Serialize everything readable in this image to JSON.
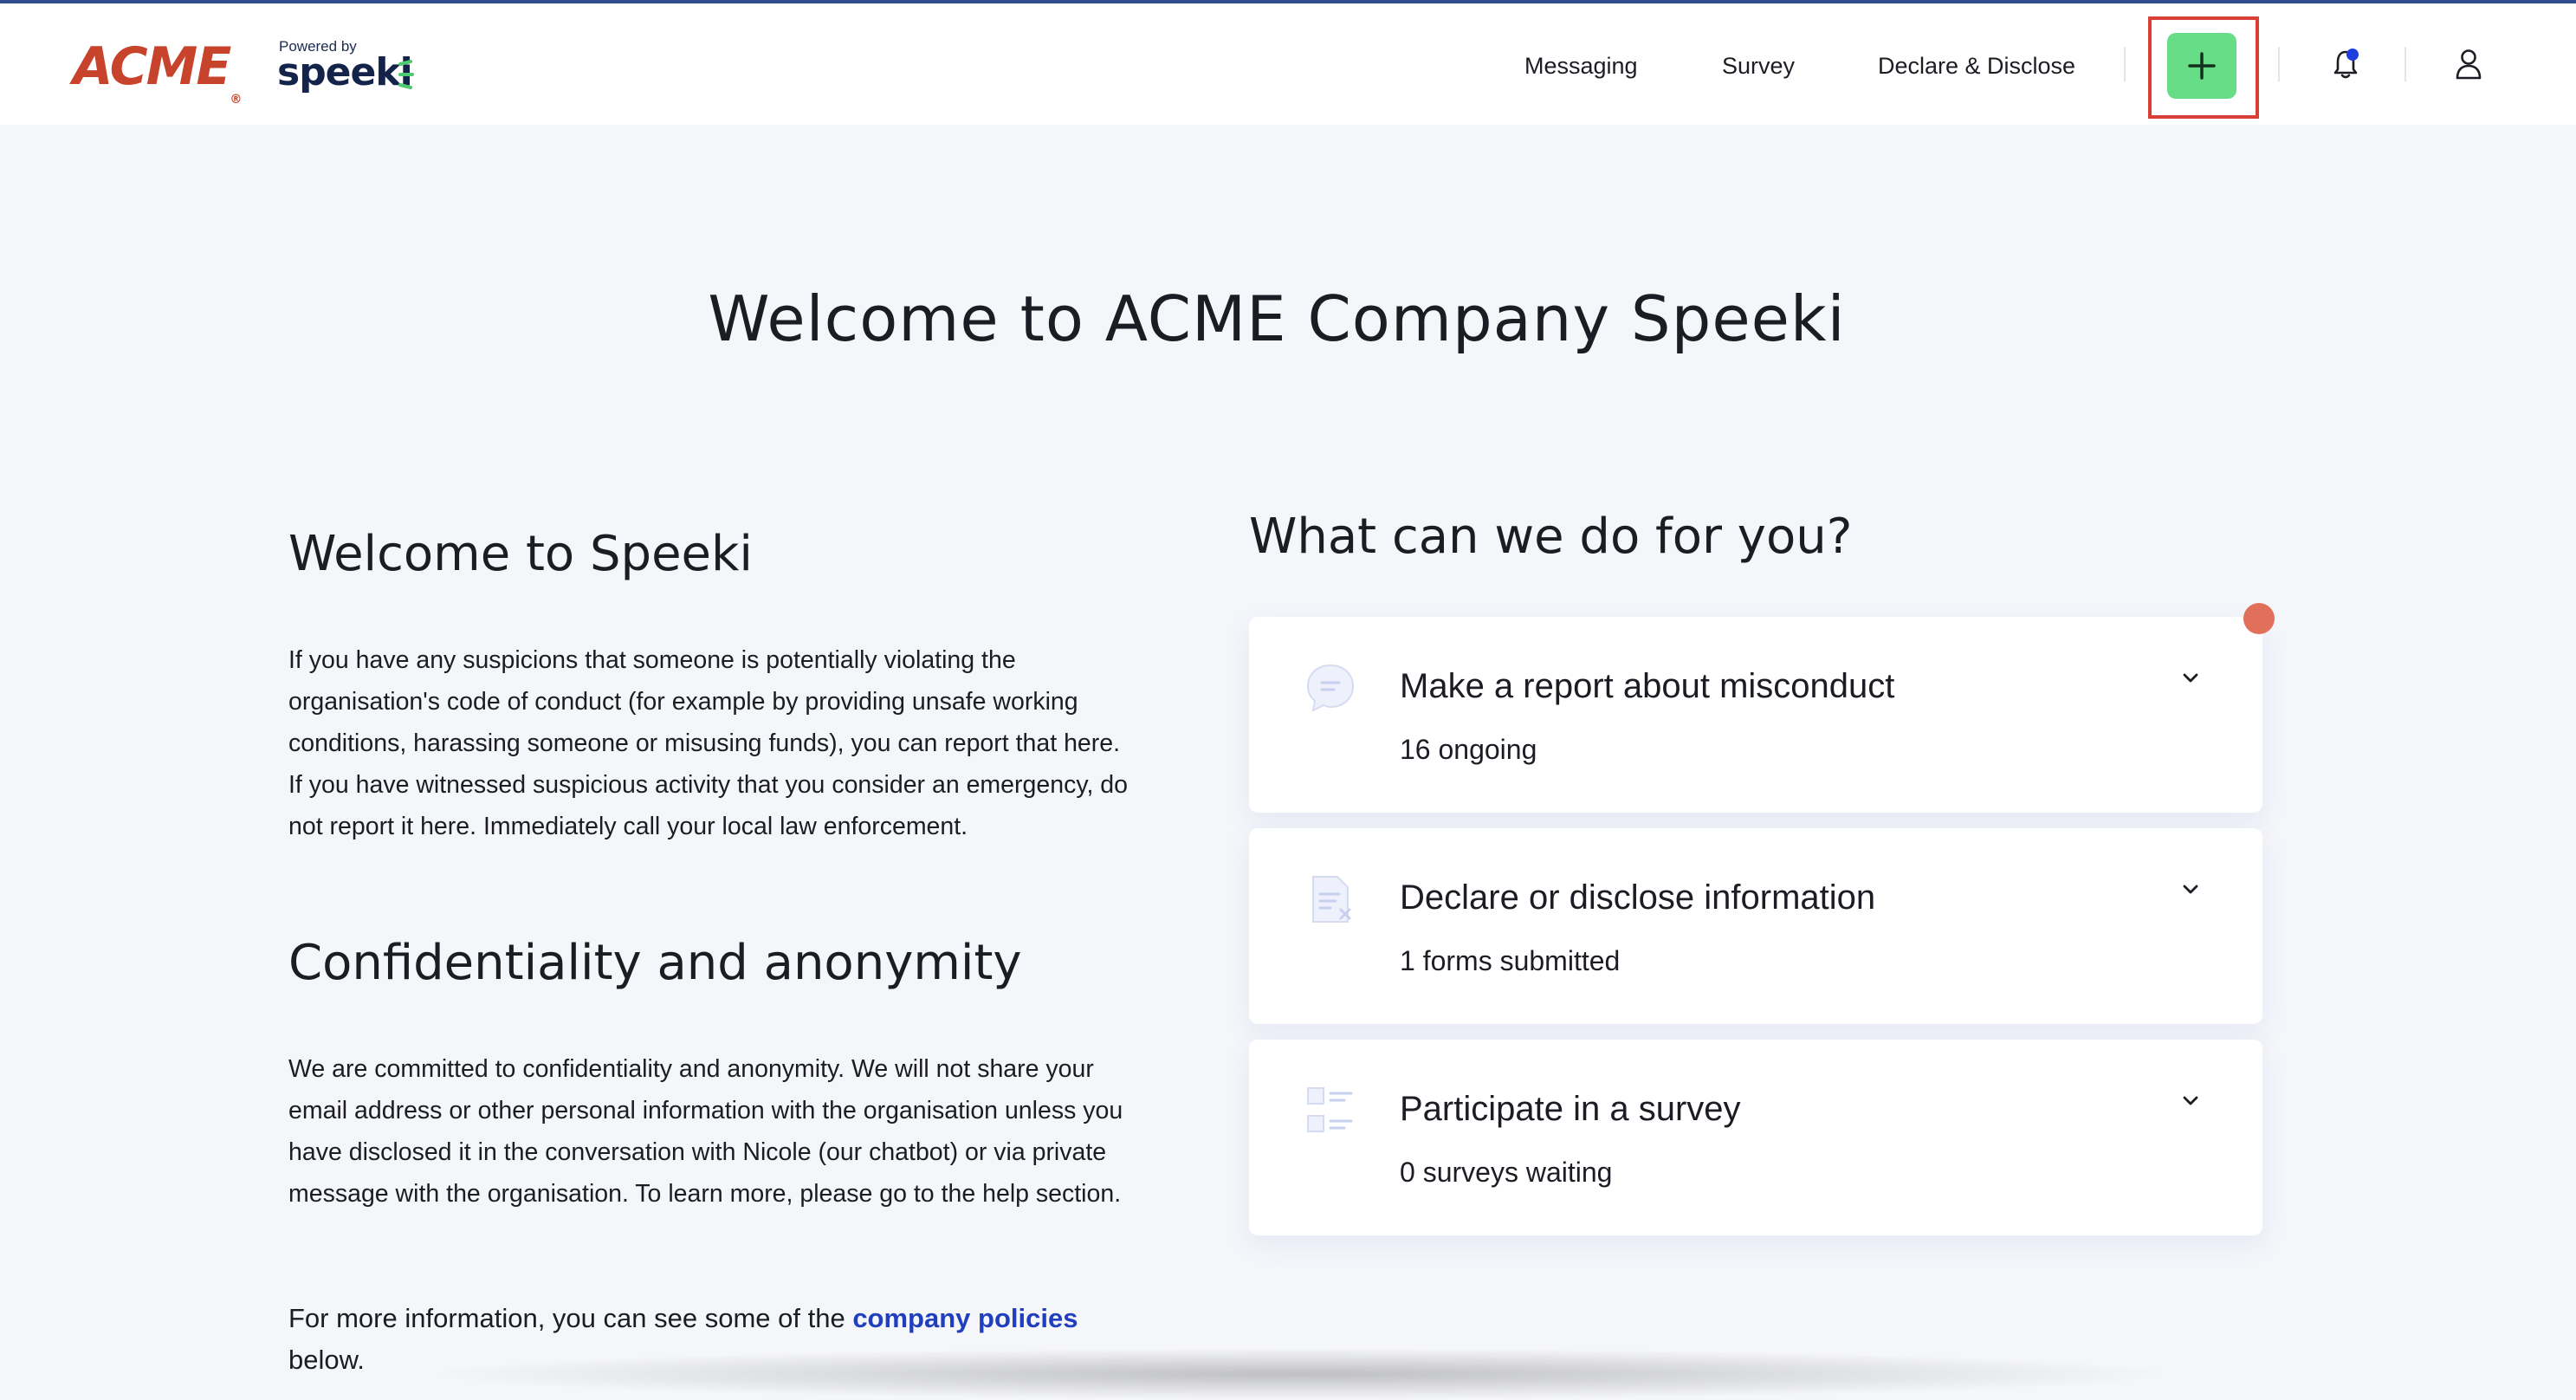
{
  "header": {
    "brand_logo_text": "ACME",
    "brand_logo_reg": "®",
    "powered_by": "Powered by",
    "product_name": "speeki",
    "nav": [
      {
        "label": "Messaging"
      },
      {
        "label": "Survey"
      },
      {
        "label": "Declare & Disclose"
      }
    ],
    "add_button_symbol": "+",
    "notification_dot_color": "#1d3fe0"
  },
  "page_title": "Welcome to ACME Company Speeki",
  "left": {
    "welcome_heading": "Welcome to Speeki",
    "welcome_text": "If you have any suspicions that someone is potentially violating the organisation's code of conduct (for example by providing unsafe working conditions, harassing someone or misusing funds), you can report that here. If you have witnessed suspicious activity that you consider an emergency, do not report it here. Immediately call your local law enforcement.",
    "confidentiality_heading": "Confidentiality and anonymity",
    "confidentiality_text": "We are committed to confidentiality and anonymity. We will not share your email address or other personal information with the organisation unless you have disclosed it in the conversation with Nicole (our chatbot) or via private message with the organisation. To learn more, please go to the help section.",
    "more_info_prefix": "For more information, you can see some of the ",
    "policies_link": "company policies",
    "more_info_suffix": "below."
  },
  "right": {
    "heading": "What can we do for you?",
    "cards": [
      {
        "title": "Make a report about misconduct",
        "subtitle": "16 ongoing",
        "icon": "chat-bubble-icon"
      },
      {
        "title": "Declare or disclose information",
        "subtitle": "1 forms submitted",
        "icon": "document-icon"
      },
      {
        "title": "Participate in a survey",
        "subtitle": "0 surveys waiting",
        "icon": "checklist-icon"
      }
    ]
  },
  "colors": {
    "accent_green": "#66dd86",
    "highlight_red": "#d64035",
    "link_blue": "#1f3fbf",
    "brand_red": "#c8432c",
    "alert_orange": "#e0705a"
  }
}
